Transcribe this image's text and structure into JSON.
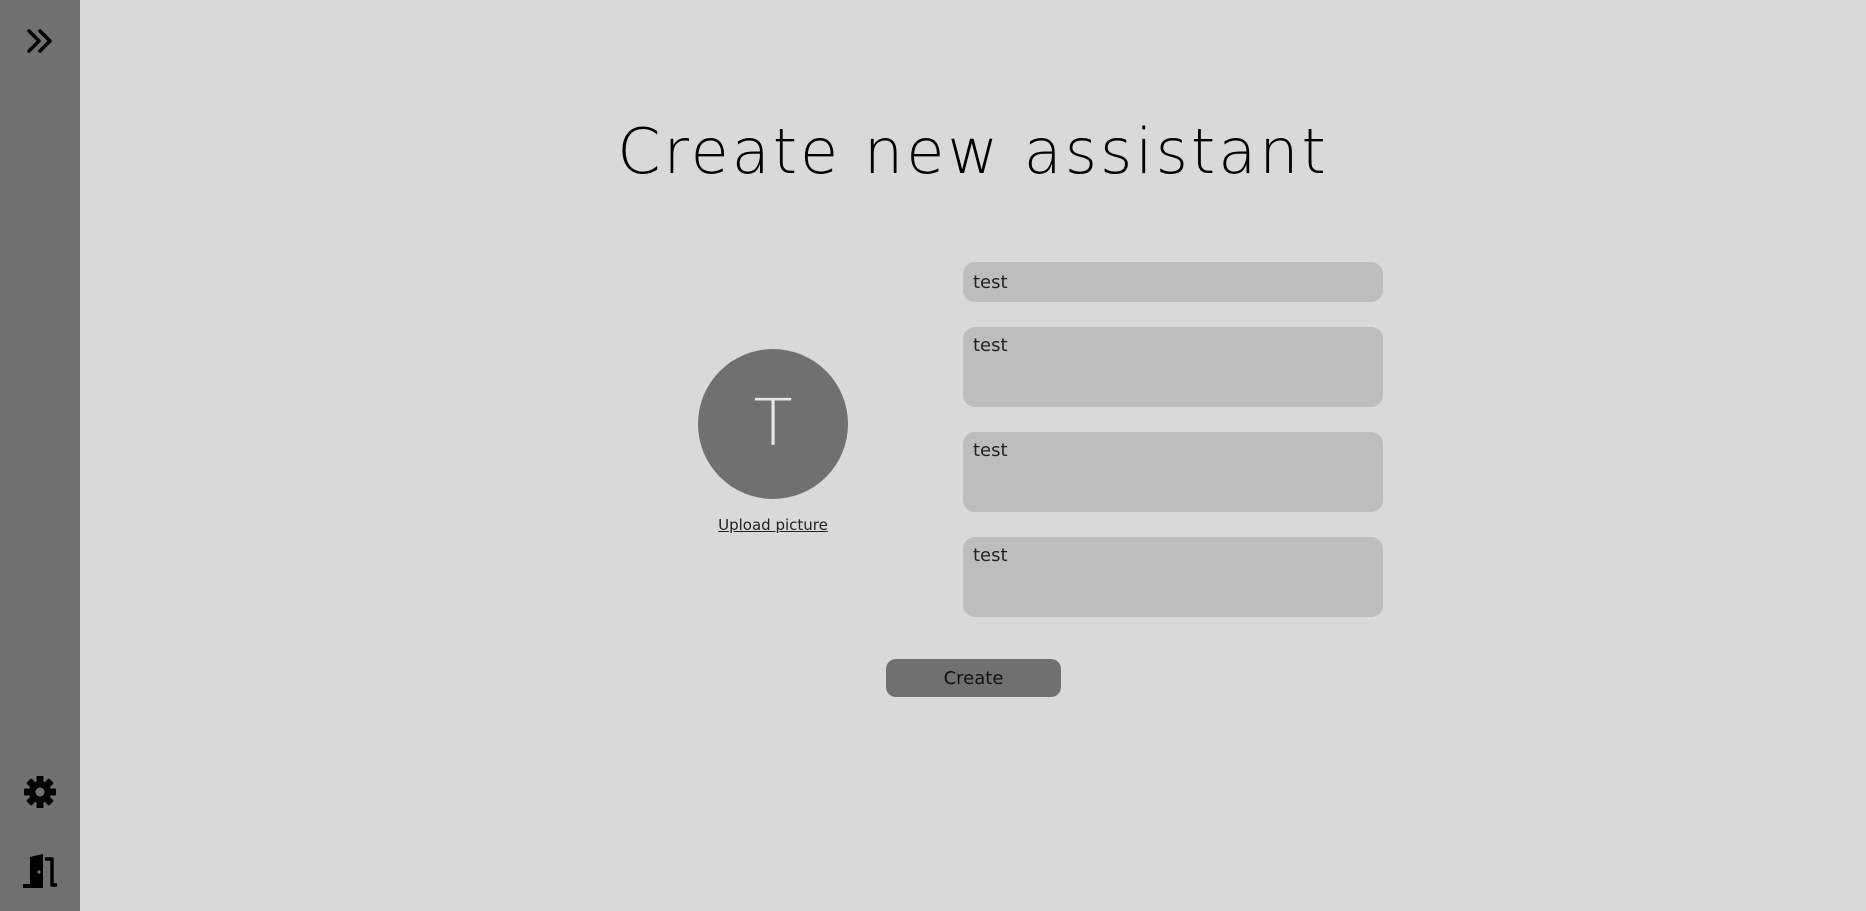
{
  "sidebar": {
    "icons": [
      "chevron-double-right-icon",
      "gear-icon",
      "exit-door-icon"
    ]
  },
  "main": {
    "title": "Create new assistant",
    "avatar": {
      "initial": "T"
    },
    "upload_label": "Upload picture",
    "fields": [
      {
        "value": "test"
      },
      {
        "value": "test"
      },
      {
        "value": "test"
      },
      {
        "value": "test"
      }
    ],
    "create_label": "Create"
  },
  "colors": {
    "background": "#d9d9d9",
    "sidebar": "#707070",
    "field": "#bdbdbd",
    "button": "#707070",
    "avatar": "#707070"
  }
}
